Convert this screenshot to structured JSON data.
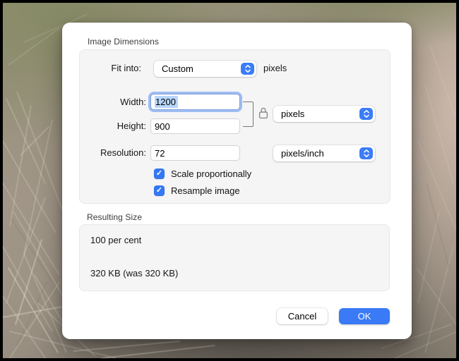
{
  "colors": {
    "accent_blue": "#3b7af7",
    "checkbox_blue": "#3478f6",
    "focus_ring": "#82aaf0",
    "text_selection": "#b8d6fb",
    "dialog_bg": "#ffffff",
    "groupbox_bg": "#f5f5f6",
    "background_green": "#8a8e70",
    "background_tan": "#a0917f"
  },
  "image_dimensions": {
    "section_label": "Image Dimensions",
    "fit_into": {
      "label": "Fit into:",
      "selected": "Custom",
      "suffix": "pixels"
    },
    "width": {
      "label": "Width:",
      "value": "1200"
    },
    "height": {
      "label": "Height:",
      "value": "900"
    },
    "size_unit": {
      "selected": "pixels"
    },
    "resolution": {
      "label": "Resolution:",
      "value": "72"
    },
    "resolution_unit": {
      "selected": "pixels/inch"
    },
    "scale_proportionally": {
      "label": "Scale proportionally",
      "checked": true
    },
    "resample_image": {
      "label": "Resample image",
      "checked": true
    }
  },
  "resulting_size": {
    "section_label": "Resulting Size",
    "percent": "100 per cent",
    "file_size": "320 KB (was 320 KB)"
  },
  "actions": {
    "cancel": "Cancel",
    "ok": "OK"
  },
  "icons": {
    "check": "✓",
    "lock": "closed-padlock",
    "stepper": "up-down-chevrons"
  }
}
